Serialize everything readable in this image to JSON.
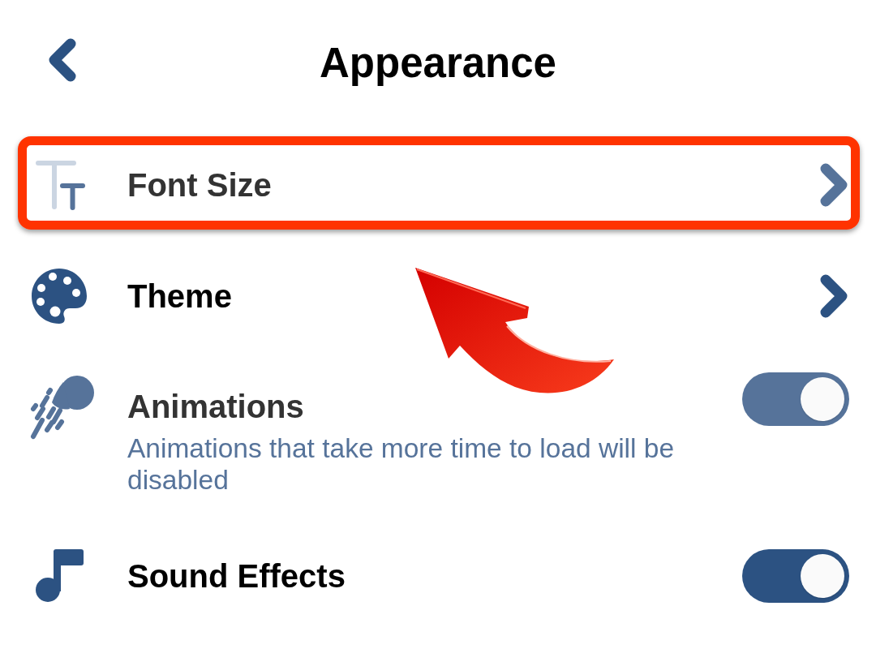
{
  "header": {
    "title": "Appearance"
  },
  "items": [
    {
      "kind": "link",
      "title": "Font Size",
      "dimmed": true,
      "highlighted": true
    },
    {
      "kind": "link",
      "title": "Theme",
      "dimmed": false,
      "highlighted": false
    },
    {
      "kind": "toggle",
      "title": "Animations",
      "description": "Animations that take more time to load will be disabled",
      "dimmed": true,
      "highlighted": false,
      "on": true
    },
    {
      "kind": "toggle",
      "title": "Sound Effects",
      "dimmed": false,
      "highlighted": false,
      "on": true
    }
  ]
}
